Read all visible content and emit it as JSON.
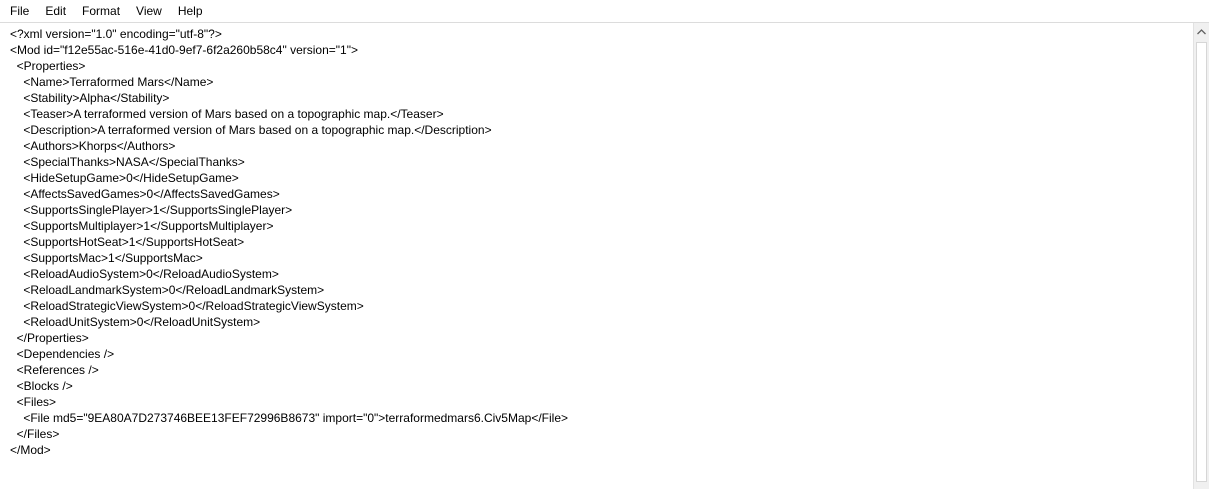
{
  "menu": {
    "items": [
      "File",
      "Edit",
      "Format",
      "View",
      "Help"
    ]
  },
  "editor": {
    "lines": [
      "<?xml version=\"1.0\" encoding=\"utf-8\"?>",
      "<Mod id=\"f12e55ac-516e-41d0-9ef7-6f2a260b58c4\" version=\"1\">",
      "  <Properties>",
      "    <Name>Terraformed Mars</Name>",
      "    <Stability>Alpha</Stability>",
      "    <Teaser>A terraformed version of Mars based on a topographic map.</Teaser>",
      "    <Description>A terraformed version of Mars based on a topographic map.</Description>",
      "    <Authors>Khorps</Authors>",
      "    <SpecialThanks>NASA</SpecialThanks>",
      "    <HideSetupGame>0</HideSetupGame>",
      "    <AffectsSavedGames>0</AffectsSavedGames>",
      "    <SupportsSinglePlayer>1</SupportsSinglePlayer>",
      "    <SupportsMultiplayer>1</SupportsMultiplayer>",
      "    <SupportsHotSeat>1</SupportsHotSeat>",
      "    <SupportsMac>1</SupportsMac>",
      "    <ReloadAudioSystem>0</ReloadAudioSystem>",
      "    <ReloadLandmarkSystem>0</ReloadLandmarkSystem>",
      "    <ReloadStrategicViewSystem>0</ReloadStrategicViewSystem>",
      "    <ReloadUnitSystem>0</ReloadUnitSystem>",
      "  </Properties>",
      "  <Dependencies />",
      "  <References />",
      "  <Blocks />",
      "  <Files>",
      "    <File md5=\"9EA80A7D273746BEE13FEF72996B8673\" import=\"0\">terraformedmars6.Civ5Map</File>",
      "  </Files>",
      "</Mod>"
    ]
  },
  "icons": {
    "scroll_up": "chevron-up-icon"
  }
}
